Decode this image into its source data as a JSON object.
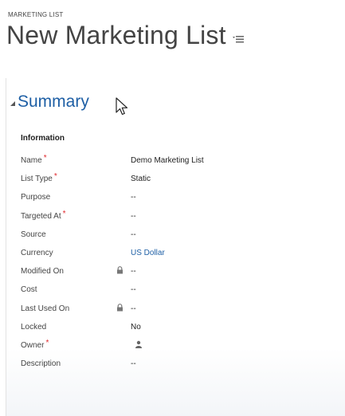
{
  "header": {
    "entity_label": "MARKETING LIST",
    "title": "New Marketing List"
  },
  "summary": {
    "section_title": "Summary",
    "subsection_title": "Information",
    "fields": [
      {
        "label": "Name",
        "required": true,
        "locked": false,
        "value": "Demo Marketing List"
      },
      {
        "label": "List Type",
        "required": true,
        "locked": false,
        "value": "Static"
      },
      {
        "label": "Purpose",
        "required": false,
        "locked": false,
        "value": "--"
      },
      {
        "label": "Targeted At",
        "required": true,
        "locked": false,
        "value": "--"
      },
      {
        "label": "Source",
        "required": false,
        "locked": false,
        "value": "--"
      },
      {
        "label": "Currency",
        "required": false,
        "locked": false,
        "value": "US Dollar"
      },
      {
        "label": "Modified On",
        "required": false,
        "locked": true,
        "value": "--"
      },
      {
        "label": "Cost",
        "required": false,
        "locked": false,
        "value": "--"
      },
      {
        "label": "Last Used On",
        "required": false,
        "locked": true,
        "value": "--"
      },
      {
        "label": "Locked",
        "required": false,
        "locked": false,
        "value": "No"
      },
      {
        "label": "Owner",
        "required": true,
        "locked": false,
        "value": ""
      },
      {
        "label": "Description",
        "required": false,
        "locked": false,
        "value": "--"
      }
    ],
    "required_marker": "*"
  },
  "icons": {
    "title_menu": "list-menu-icon",
    "collapse": "collapse-triangle-icon",
    "lock": "lock-icon",
    "owner": "user-icon",
    "cursor": "mouse-pointer-icon"
  },
  "colors": {
    "accent": "#1e5fa5",
    "required": "#e0282d"
  }
}
